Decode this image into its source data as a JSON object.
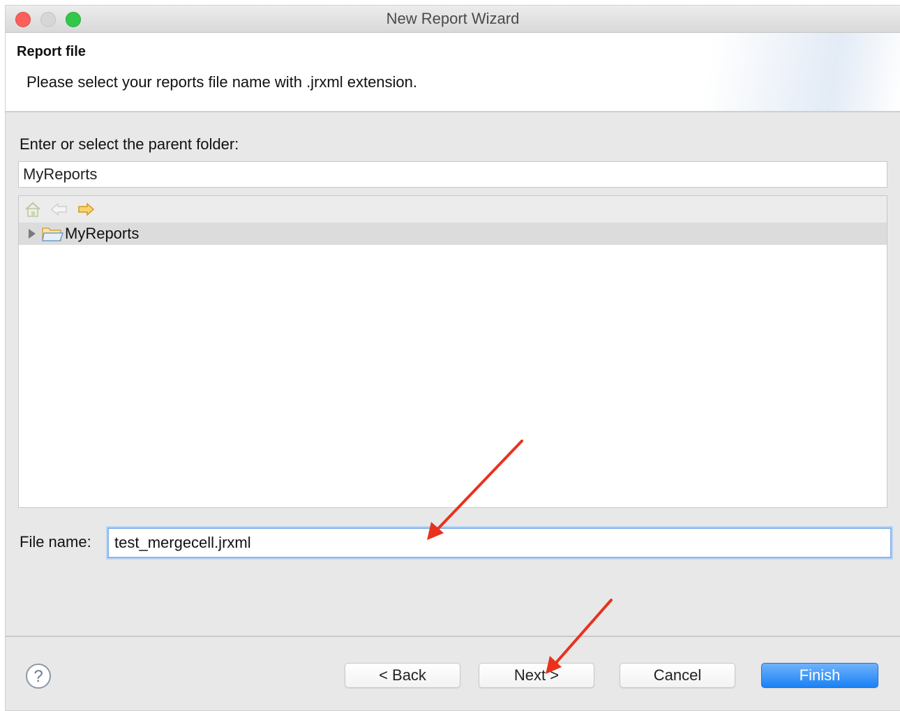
{
  "window": {
    "title": "New Report Wizard"
  },
  "header": {
    "title": "Report file",
    "description": "Please select your reports file name with .jrxml extension."
  },
  "folder": {
    "label": "Enter or select the parent folder:",
    "value": "MyReports"
  },
  "tree": {
    "items": [
      {
        "label": "MyReports",
        "expanded": false,
        "selected": true
      }
    ]
  },
  "file": {
    "label": "File name:",
    "value": "test_mergecell.jrxml"
  },
  "buttons": {
    "back": "< Back",
    "next": "Next >",
    "cancel": "Cancel",
    "finish": "Finish"
  },
  "colors": {
    "accent": "#1a82f5",
    "annotation_arrow": "#e8321e",
    "close": "#fc605c",
    "maximize": "#34c84a"
  }
}
